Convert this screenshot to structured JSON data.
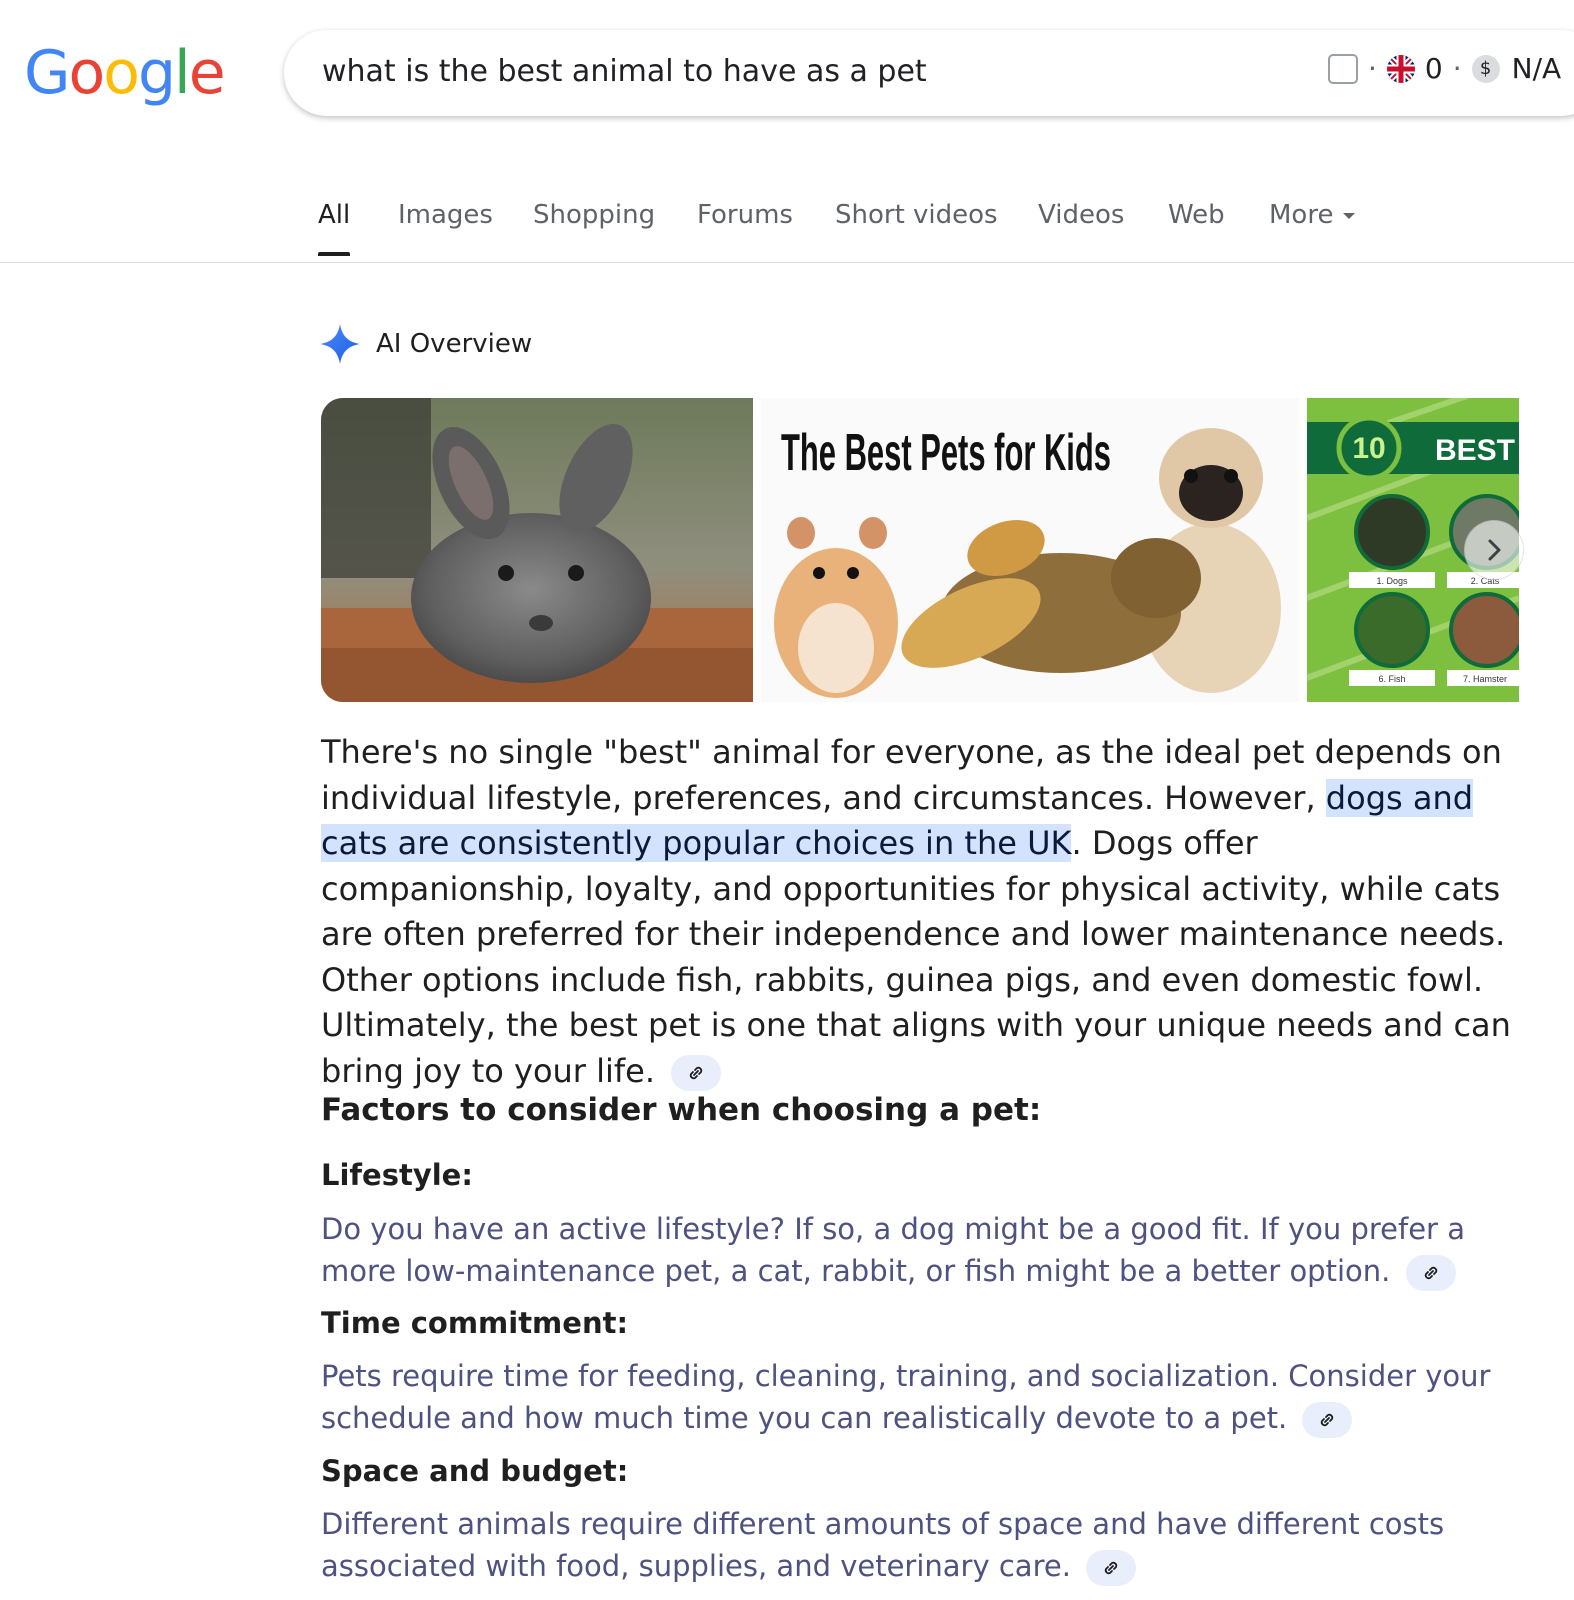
{
  "logo": {
    "letters": [
      "G",
      "o",
      "o",
      "g",
      "l",
      "e"
    ],
    "colors": [
      "#4285F4",
      "#EA4335",
      "#FBBC05",
      "#4285F4",
      "#34A853",
      "#EA4335"
    ]
  },
  "search": {
    "query": "what is the best animal to have as a pet",
    "extension": {
      "dot": "·",
      "count": "0",
      "dollar_icon": "$",
      "value": "N/A"
    }
  },
  "tabs": [
    {
      "label": "All",
      "active": true
    },
    {
      "label": "Images"
    },
    {
      "label": "Shopping"
    },
    {
      "label": "Forums"
    },
    {
      "label": "Short videos"
    },
    {
      "label": "Videos"
    },
    {
      "label": "Web"
    },
    {
      "label": "More"
    }
  ],
  "ai_overview": {
    "label": "AI Overview",
    "images": [
      {
        "name": "chinchilla-image"
      },
      {
        "name": "best-pets-for-kids-image",
        "title": "The Best Pets for Kids"
      },
      {
        "name": "best-animals-image",
        "badge": "10",
        "title": "BEST AN",
        "captions": [
          "1. Dogs",
          "2. Cats",
          "6. Fish",
          "7. Hamster"
        ]
      }
    ],
    "intro_before": "There's no single \"best\" animal for everyone, as the ideal pet depends on individual lifestyle, preferences, and circumstances. However, ",
    "intro_highlight": "dogs and cats are consistently popular choices in the UK",
    "intro_after": ". Dogs offer companionship, loyalty, and opportunities for physical activity, while cats are often preferred for their independence and lower maintenance needs. Other options include fish, rabbits, guinea pigs, and even domestic fowl. Ultimately, the best pet is one that aligns with your unique needs and can bring joy to your life.",
    "factors_heading": "Factors to consider when choosing a pet:",
    "factors": [
      {
        "title": "Lifestyle:",
        "body": "Do you have an active lifestyle? If so, a dog might be a good fit. If you prefer a more low-maintenance pet, a cat, rabbit, or fish might be a better option."
      },
      {
        "title": "Time commitment:",
        "body": "Pets require time for feeding, cleaning, training, and socialization. Consider your schedule and how much time you can realistically devote to a pet."
      },
      {
        "title": "Space and budget:",
        "body": "Different animals require different amounts of space and have different costs associated with food, supplies, and veterinary care."
      }
    ]
  },
  "colors": {
    "accent": "#1a73e8",
    "highlight": "#d3e3fd",
    "factor_text": "#4d5281"
  }
}
